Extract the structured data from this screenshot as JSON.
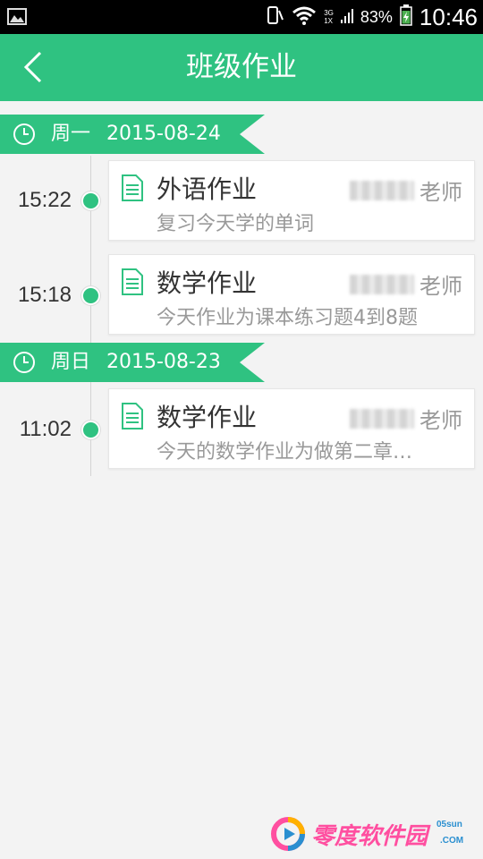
{
  "status_bar": {
    "network_3g": "3G",
    "network_1x": "1X",
    "battery_percent": "83%",
    "time": "10:46"
  },
  "app_bar": {
    "title": "班级作业",
    "back_icon": "chevron-left-icon"
  },
  "colors": {
    "accent": "#2fc281",
    "background": "#f3f3f3",
    "card": "#ffffff",
    "muted_text": "#999999"
  },
  "groups": [
    {
      "weekday": "周一",
      "date": "2015-08-24",
      "items": [
        {
          "time": "15:22",
          "title": "外语作业",
          "teacher_suffix": "老师",
          "description": "复习今天学的单词"
        },
        {
          "time": "15:18",
          "title": "数学作业",
          "teacher_suffix": "老师",
          "description": "今天作业为课本练习题4到8题"
        }
      ]
    },
    {
      "weekday": "周日",
      "date": "2015-08-23",
      "items": [
        {
          "time": "11:02",
          "title": "数学作业",
          "teacher_suffix": "老师",
          "description": "今天的数学作业为做第二章…"
        }
      ]
    }
  ],
  "watermark": {
    "brand": "零度软件园",
    "site": "05sun",
    "domain": ".COM"
  }
}
